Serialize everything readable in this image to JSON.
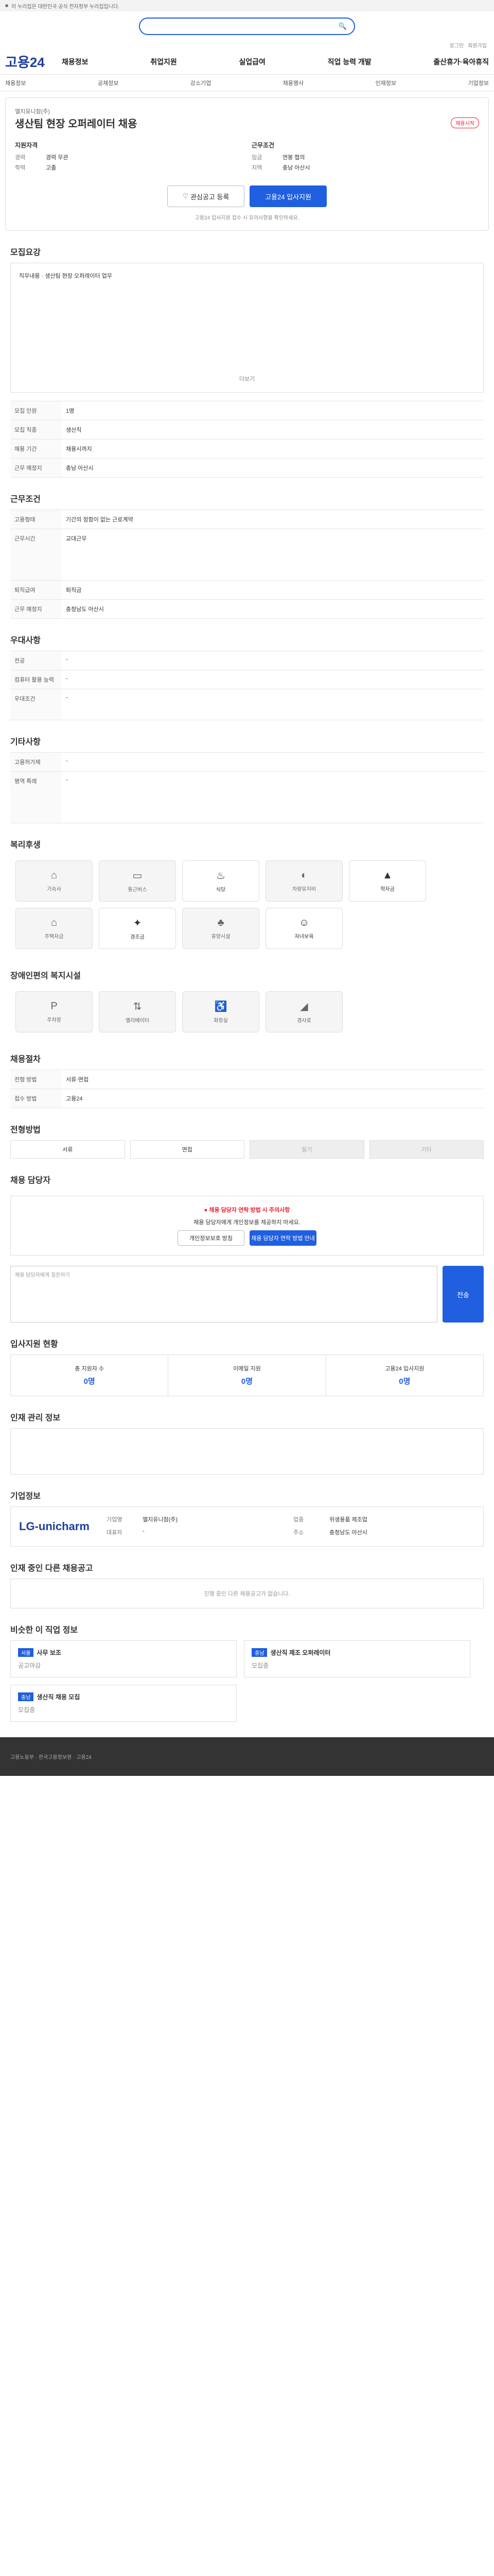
{
  "gov": {
    "text": "이 누리집은 대한민국 공식 전자정부 누리집입니다."
  },
  "search": {
    "placeholder": "",
    "icon": "search-icon"
  },
  "util": [
    "로그인",
    "회원가입"
  ],
  "gnb": {
    "logo": "고용24",
    "menu": [
      "채용정보",
      "취업지원",
      "실업급여",
      "직업 능력 개발",
      "출산휴가·육아휴직"
    ]
  },
  "sub": [
    "채용정보",
    "공채정보",
    "강소기업",
    "채용행사",
    "인재정보",
    "기업정보"
  ],
  "job": {
    "company": "엘지유니참(주)",
    "title": "생산팀 현장 오퍼레이터 채용",
    "badge": "채용시작",
    "left": {
      "h": "지원자격",
      "rows": [
        [
          "경력",
          "경력 무관"
        ],
        [
          "학력",
          "고졸"
        ]
      ]
    },
    "right": {
      "h": "근무조건",
      "rows": [
        [
          "임금",
          "연봉 협의"
        ],
        [
          "지역",
          "충남 아산시"
        ]
      ]
    },
    "btn_fav": "관심공고 등록",
    "btn_apply": "고용24 입사지원",
    "note": "고용24 입사지원 접수 시 유의사항을 확인하세요."
  },
  "detail": {
    "h": "모집요강",
    "text": "직무내용 · 생산팀 현장 오퍼레이터 업무",
    "more": "더보기"
  },
  "recruit_rows": [
    [
      "모집 인원",
      "1명"
    ],
    [
      "모집 직종",
      "생산직"
    ],
    [
      "채용 기간",
      "채용시까지"
    ],
    [
      "근무 예정지",
      "충남 아산시"
    ]
  ],
  "cond": {
    "h": "근무조건"
  },
  "cond_rows": [
    [
      "고용형태",
      "기간의 정함이 없는 근로계약"
    ],
    [
      "근무시간",
      "교대근무"
    ],
    [
      "퇴직급여",
      "퇴직금"
    ],
    [
      "근무 예정지",
      "충청남도 아산시"
    ]
  ],
  "welfare": {
    "h": "우대사항"
  },
  "welfare_rows": [
    [
      "전공",
      "-"
    ],
    [
      "컴퓨터 활용 능력",
      "-"
    ],
    [
      "우대조건",
      "-"
    ]
  ],
  "extra": {
    "h": "기타사항",
    "rows": [
      [
        "고용허가제",
        "-"
      ],
      [
        "병역 특례",
        "-"
      ]
    ]
  },
  "benefit": {
    "h": "복리후생",
    "items": [
      [
        "기숙사",
        "home-icon"
      ],
      [
        "통근버스",
        "bus-icon"
      ],
      [
        "식당",
        "dining-icon"
      ],
      [
        "차량유지비",
        "car-icon"
      ],
      [
        "학자금",
        "cap-icon"
      ],
      [
        "주택자금",
        "house-icon"
      ],
      [
        "경조금",
        "gift-icon"
      ],
      [
        "휴양시설",
        "palm-icon"
      ],
      [
        "자녀보육",
        "baby-icon"
      ]
    ]
  },
  "access": {
    "h": "장애인편의 복지시설",
    "items": [
      [
        "주차장",
        "parking-icon"
      ],
      [
        "엘리베이터",
        "elevator-icon"
      ],
      [
        "화장실",
        "toilet-icon"
      ],
      [
        "경사로",
        "ramp-icon"
      ]
    ]
  },
  "process": {
    "h": "채용절차",
    "rows": [
      [
        "전형 방법",
        "서류·면접"
      ],
      [
        "접수 방법",
        "고용24"
      ]
    ]
  },
  "apply": {
    "h": "전형방법",
    "tabs": [
      "서류",
      "면접",
      "필기",
      "기타"
    ]
  },
  "contact": {
    "h": "채용 담당자",
    "alert_title": "채용 담당자 연락 방법 시 주의사항",
    "alert_text": "채용 담당자에게 개인정보를 제공하지 마세요.",
    "btn1": "개인정보보호 방침",
    "btn2": "채용 담당자 연락 방법 안내",
    "textarea_placeholder": "채용 담당자에게 질문하기",
    "send": "전송"
  },
  "stats": {
    "h": "입사지원 현황",
    "items": [
      [
        "총 지원자 수",
        "0명"
      ],
      [
        "이메일 지원",
        "0명"
      ],
      [
        "고용24 입사지원",
        "0명"
      ]
    ]
  },
  "manage": {
    "h": "인재 관리 정보"
  },
  "companyinfo": {
    "h": "기업정보",
    "logo": "LG-unicharm",
    "rows": [
      [
        "기업명",
        "엘지유니참(주)"
      ],
      [
        "업종",
        "위생용품 제조업"
      ],
      [
        "대표자",
        "-"
      ],
      [
        "주소",
        "충청남도 아산시"
      ]
    ]
  },
  "related": {
    "h": "인재 중인 다른 채용공고",
    "empty": "진행 중인 다른 채용공고가 없습니다."
  },
  "similar": {
    "h": "비슷한 이 직업 정보",
    "cards": [
      [
        "서울",
        "사무 보조",
        "공고마감"
      ],
      [
        "충남",
        "생산직 제조 오퍼레이터",
        "모집중"
      ],
      [
        "충남",
        "생산직 채용 모집",
        "모집중"
      ]
    ]
  },
  "footer": {
    "text": "고용노동부 · 한국고용정보원 · 고용24"
  }
}
